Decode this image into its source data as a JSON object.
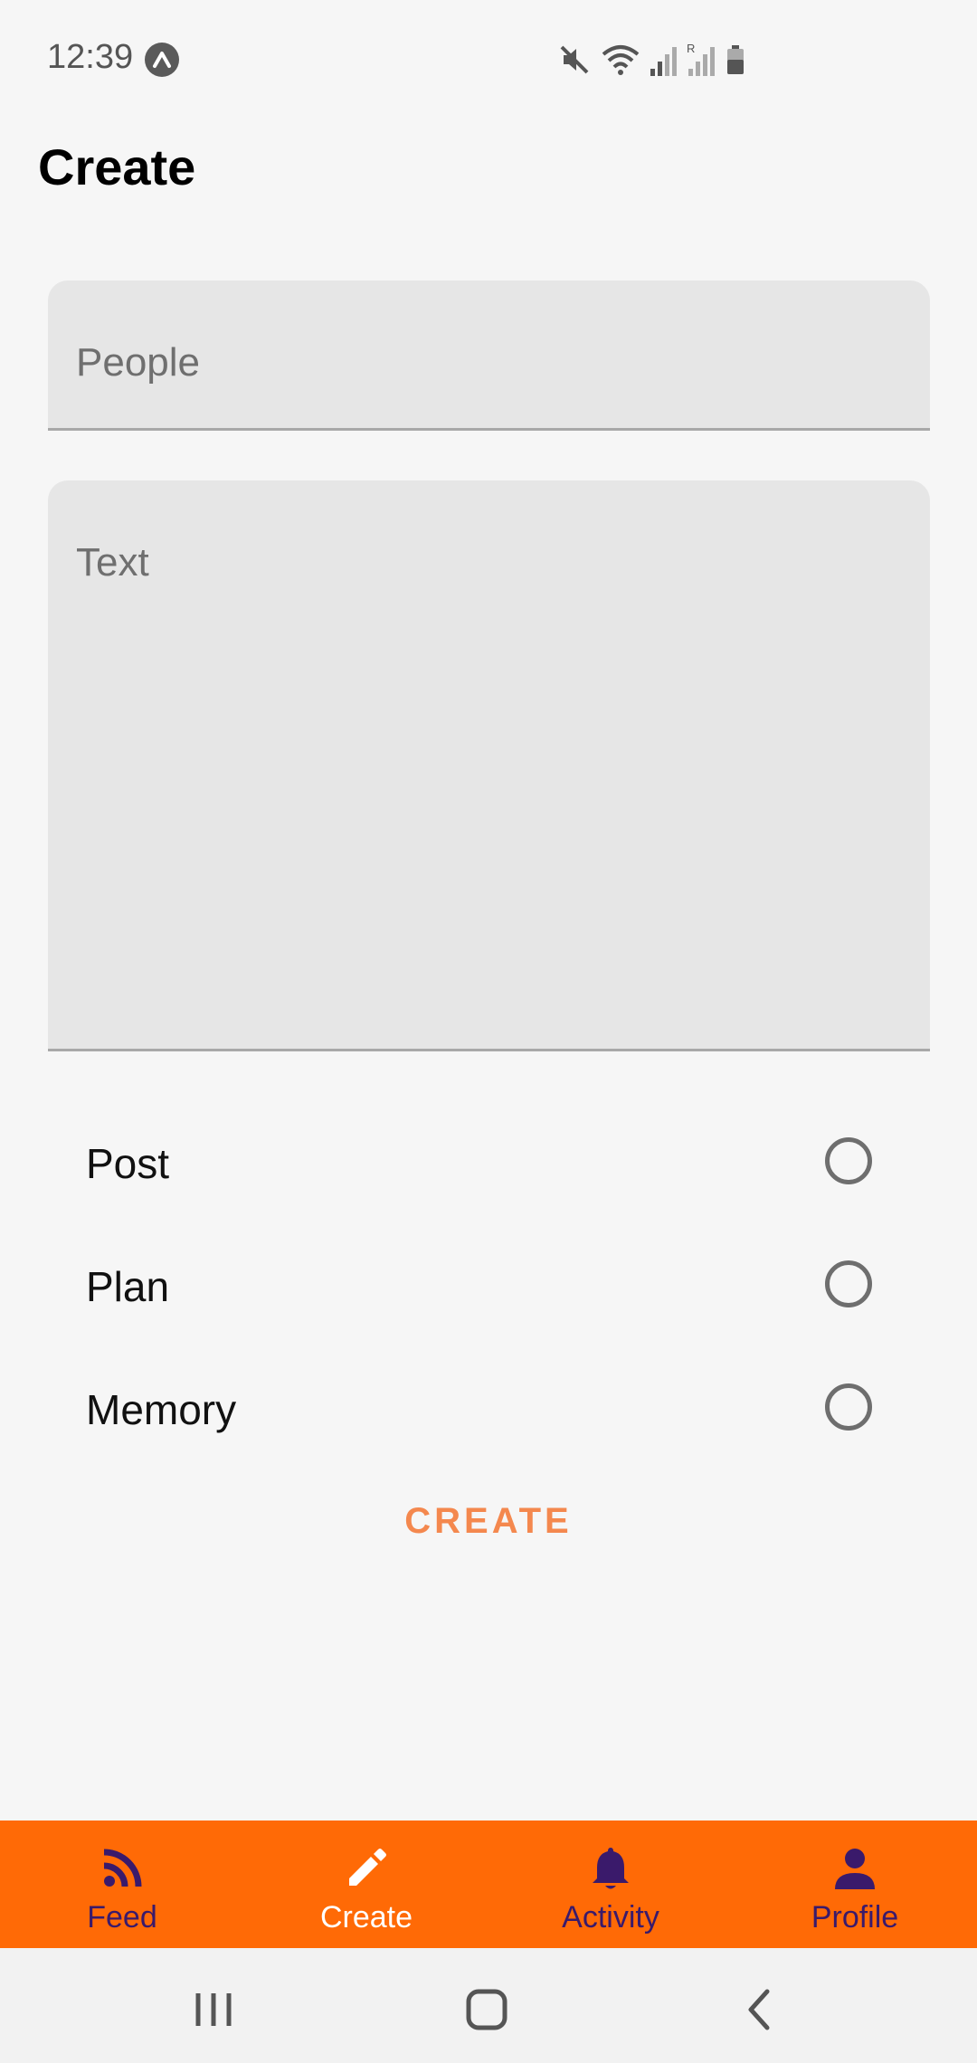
{
  "status_bar": {
    "time": "12:39",
    "icons": [
      "app-notification-icon",
      "mute-icon",
      "wifi-icon",
      "signal-icon",
      "roaming-signal-icon",
      "battery-icon"
    ]
  },
  "header": {
    "title": "Create"
  },
  "form": {
    "people_placeholder": "People",
    "text_placeholder": "Text",
    "options": [
      {
        "label": "Post",
        "selected": false
      },
      {
        "label": "Plan",
        "selected": false
      },
      {
        "label": "Memory",
        "selected": false
      }
    ],
    "submit_label": "CREATE"
  },
  "bottom_nav": {
    "background": "#ff6a06",
    "active_color": "#ffffff",
    "inactive_color": "#3a1a6b",
    "items": [
      {
        "label": "Feed",
        "icon": "rss-feed-icon",
        "active": false
      },
      {
        "label": "Create",
        "icon": "pencil-icon",
        "active": true
      },
      {
        "label": "Activity",
        "icon": "bell-icon",
        "active": false
      },
      {
        "label": "Profile",
        "icon": "person-icon",
        "active": false
      }
    ]
  },
  "accent_color": "#f4884e",
  "system_nav": {
    "buttons": [
      "recent-apps-icon",
      "home-icon",
      "back-icon"
    ]
  }
}
